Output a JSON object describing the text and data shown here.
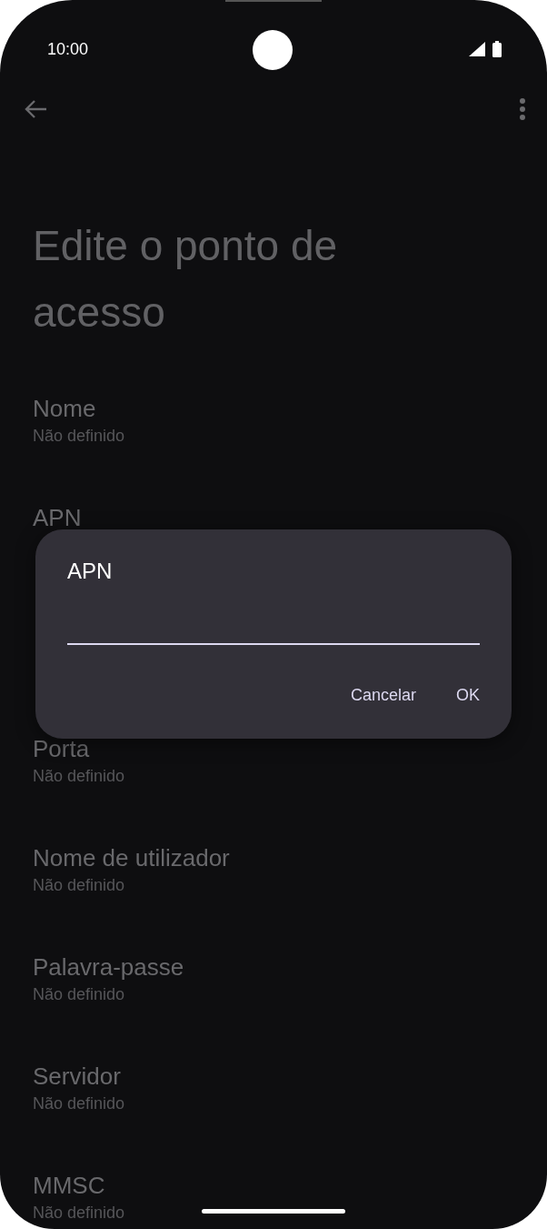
{
  "status_bar": {
    "time": "10:00"
  },
  "title": "Edite o ponto de acesso",
  "settings": [
    {
      "label": "Nome",
      "value": "Não definido"
    },
    {
      "label": "APN"
    }
  ],
  "settings_below_dialog": [
    {
      "label": "Porta",
      "value": "Não definido"
    },
    {
      "label": "Nome de utilizador",
      "value": "Não definido"
    },
    {
      "label": "Palavra-passe",
      "value": "Não definido"
    },
    {
      "label": "Servidor",
      "value": "Não definido"
    },
    {
      "label": "MMSC",
      "value": "Não definido"
    }
  ],
  "dialog": {
    "title": "APN",
    "buttons": [
      "Cancelar",
      "OK"
    ]
  }
}
